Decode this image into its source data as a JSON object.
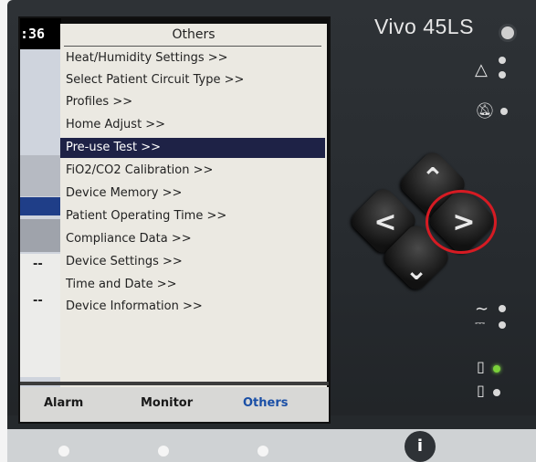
{
  "device": {
    "brand": "Vivo 45LS",
    "info_label": "i"
  },
  "screen": {
    "time_fragment": ":36",
    "left_values": [
      "--",
      "--"
    ],
    "menu": {
      "title": "Others",
      "items": [
        {
          "label": "Heat/Humidity Settings >>",
          "selected": false
        },
        {
          "label": "Select Patient Circuit Type >>",
          "selected": false
        },
        {
          "label": "Profiles >>",
          "selected": false
        },
        {
          "label": "Home Adjust >>",
          "selected": false
        },
        {
          "label": "Pre-use Test >>",
          "selected": true
        },
        {
          "label": "FiO2/CO2 Calibration >>",
          "selected": false
        },
        {
          "label": "Device Memory >>",
          "selected": false
        },
        {
          "label": "Patient Operating Time >>",
          "selected": false
        },
        {
          "label": "Compliance Data >>",
          "selected": false
        },
        {
          "label": "Device Settings >>",
          "selected": false
        },
        {
          "label": "Time and Date >>",
          "selected": false
        },
        {
          "label": "Device Information >>",
          "selected": false
        }
      ]
    },
    "tabs": [
      {
        "label": "Alarm",
        "active": false
      },
      {
        "label": "Monitor",
        "active": false
      },
      {
        "label": "Others",
        "active": true
      }
    ]
  },
  "indicators": {
    "alarm_icon": "alarm-triangle-icon",
    "mute_icon": "alarm-mute-icon",
    "ac_icon": "ac-power-icon",
    "dc_icon": "dc-power-icon",
    "battery_int_icon": "internal-battery-icon",
    "battery_ext_icon": "external-battery-icon",
    "battery_int_led": "green"
  },
  "colors": {
    "selected_row": "#1e2246",
    "active_tab": "#1a4fa6",
    "highlight_ring": "#d61b23"
  }
}
